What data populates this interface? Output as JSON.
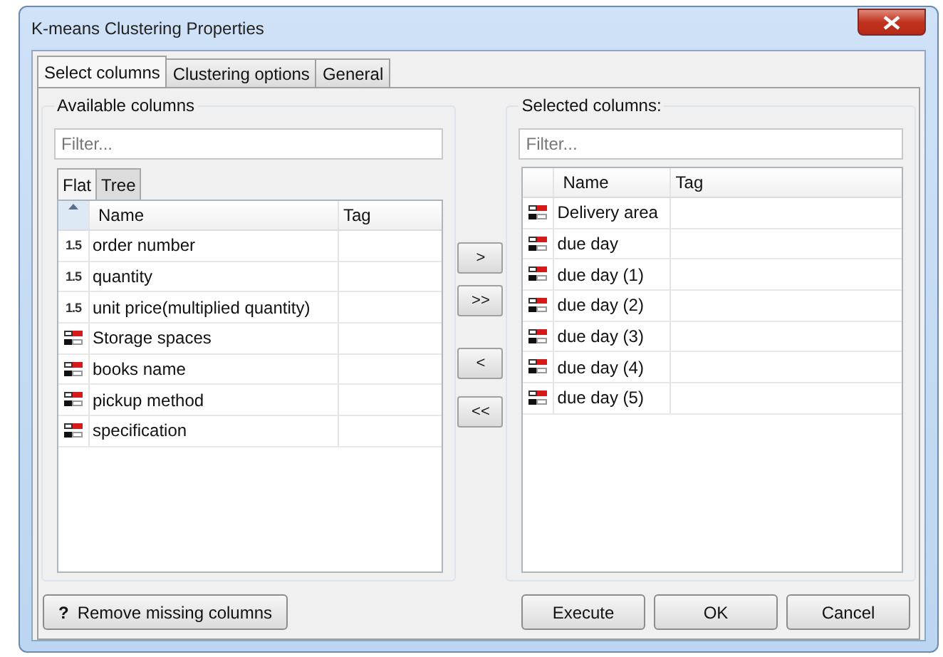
{
  "window": {
    "title": "K-means Clustering Properties"
  },
  "tabs": [
    {
      "label": "Select columns",
      "selected": true
    },
    {
      "label": "Clustering options",
      "selected": false
    },
    {
      "label": "General",
      "selected": false
    }
  ],
  "available": {
    "title": "Available columns",
    "filter": {
      "placeholder": "Filter..."
    },
    "view_tabs": [
      {
        "label": "Flat",
        "selected": true
      },
      {
        "label": "Tree",
        "selected": false
      }
    ],
    "columns": [
      "Name",
      "Tag"
    ],
    "rows": [
      {
        "kind": "number",
        "type_label": "1.5",
        "name": "order number"
      },
      {
        "kind": "number",
        "type_label": "1.5",
        "name": "quantity"
      },
      {
        "kind": "number",
        "type_label": "1.5",
        "name": "unit price(multiplied quantity)"
      },
      {
        "kind": "string",
        "name": "Storage spaces"
      },
      {
        "kind": "string",
        "name": "books name"
      },
      {
        "kind": "string",
        "name": "pickup method"
      },
      {
        "kind": "string",
        "name": "specification"
      }
    ]
  },
  "move_buttons": [
    ">",
    ">>",
    "<",
    "<<"
  ],
  "selected": {
    "title": "Selected columns:",
    "filter": {
      "placeholder": "Filter..."
    },
    "columns": [
      "Name",
      "Tag"
    ],
    "rows": [
      {
        "kind": "string",
        "name": "Delivery area"
      },
      {
        "kind": "string",
        "name": "due day"
      },
      {
        "kind": "string",
        "name": "due day (1)"
      },
      {
        "kind": "string",
        "name": "due day (2)"
      },
      {
        "kind": "string",
        "name": "due day (3)"
      },
      {
        "kind": "string",
        "name": "due day (4)"
      },
      {
        "kind": "string",
        "name": "due day (5)"
      }
    ]
  },
  "help_button": {
    "icon": "?",
    "label": "Remove missing columns"
  },
  "buttons": [
    "Execute",
    "OK",
    "Cancel"
  ]
}
